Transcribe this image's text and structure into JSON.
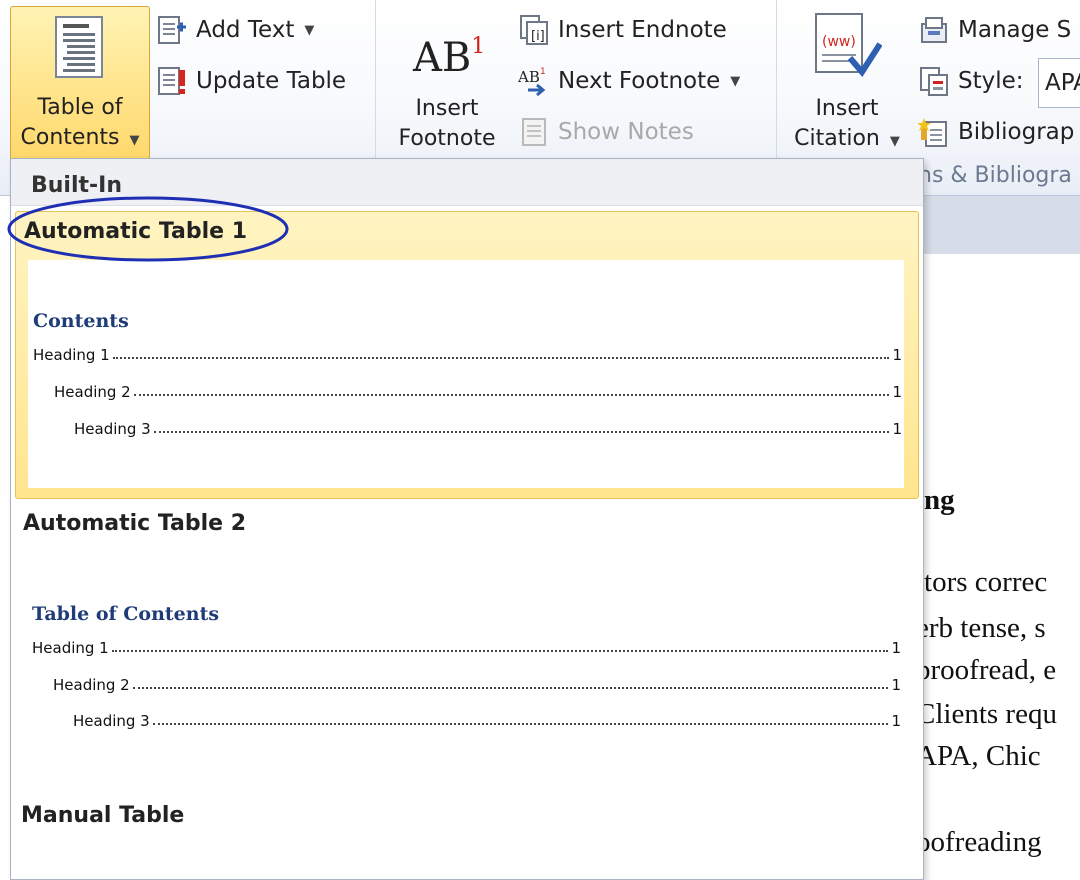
{
  "ribbon": {
    "toc_button": {
      "line1": "Table of",
      "line2": "Contents",
      "icon": "table-of-contents-icon"
    },
    "add_text": {
      "label": "Add Text",
      "icon": "add-text-icon"
    },
    "update_table": {
      "label": "Update Table",
      "icon": "update-table-icon"
    },
    "insert_footnote": {
      "line1": "Insert",
      "line2": "Footnote",
      "icon_text": "AB",
      "icon_sup": "1"
    },
    "insert_endnote": {
      "label": "Insert Endnote",
      "icon": "insert-endnote-icon"
    },
    "next_footnote": {
      "label": "Next Footnote",
      "icon": "next-footnote-icon"
    },
    "show_notes": {
      "label": "Show Notes",
      "icon": "show-notes-icon",
      "disabled": true
    },
    "insert_citation": {
      "line1": "Insert",
      "line2": "Citation",
      "icon": "insert-citation-icon"
    },
    "manage_sources": {
      "label": "Manage S",
      "icon": "manage-sources-icon"
    },
    "style": {
      "label": "Style:",
      "value": "APA",
      "icon": "style-icon"
    },
    "bibliography": {
      "label": "Bibliograp",
      "icon": "bibliography-icon"
    },
    "citations_group_label": "ns & Bibliogra"
  },
  "gallery": {
    "header": "Built-In",
    "items": [
      {
        "title": "Automatic Table 1",
        "heading": "Contents",
        "lines": [
          {
            "text": "Heading 1",
            "page": "1"
          },
          {
            "text": "Heading 2",
            "page": "1"
          },
          {
            "text": "Heading 3",
            "page": "1"
          }
        ],
        "selected": true
      },
      {
        "title": "Automatic Table 2",
        "heading": "Table of Contents",
        "lines": [
          {
            "text": "Heading 1",
            "page": "1"
          },
          {
            "text": "Heading 2",
            "page": "1"
          },
          {
            "text": "Heading 3",
            "page": "1"
          }
        ],
        "selected": false
      },
      {
        "title": "Manual Table"
      }
    ]
  },
  "document": {
    "lines": [
      "ing",
      "itors correc",
      "erb tense, s",
      "proofread, e",
      "Clients requ",
      "APA, Chic",
      "oofreading"
    ]
  },
  "colors": {
    "selection_fill": "#ffe58e",
    "selection_border": "#e8c35b",
    "toc_heading": "#1f3c78",
    "annotation_ellipse": "#1f2fb4",
    "disabled_text": "#a9a9a9"
  }
}
